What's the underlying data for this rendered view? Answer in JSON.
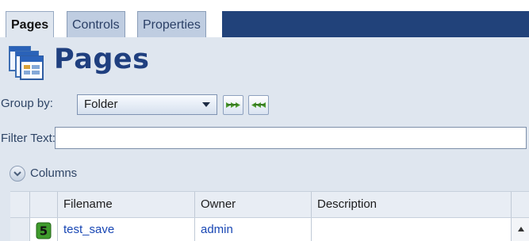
{
  "tabs": [
    {
      "label": "Pages",
      "active": true
    },
    {
      "label": "Controls",
      "active": false
    },
    {
      "label": "Properties",
      "active": false
    }
  ],
  "header": {
    "title": "Pages",
    "icon": "pages-icon"
  },
  "group_by": {
    "label": "Group by:",
    "selected": "Folder",
    "buttons": [
      "expand-all-icon",
      "collapse-all-icon"
    ]
  },
  "filter": {
    "label": "Filter Text:",
    "value": ""
  },
  "columns": {
    "label": "Columns"
  },
  "table": {
    "headers": [
      "Filename",
      "Owner",
      "Description"
    ],
    "rows": [
      {
        "icon": "page-5-icon",
        "icon_text": "5",
        "filename": "test_save",
        "owner": "admin",
        "description": ""
      }
    ]
  },
  "colors": {
    "accent": "#21427a",
    "title": "#1f3f7f",
    "link": "#1947b4",
    "background": "#dfe6ef"
  }
}
